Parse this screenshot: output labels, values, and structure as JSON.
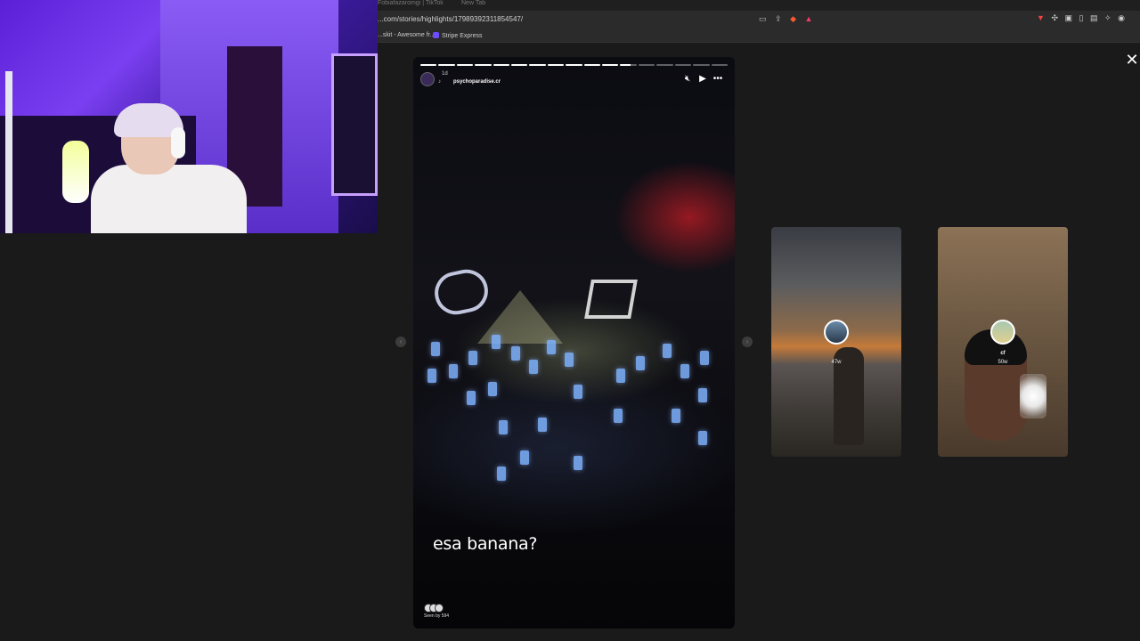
{
  "browser": {
    "tabs": [
      "Fobiafazaromgi | TikTok",
      "New Tab"
    ],
    "url": "...com/stories/highlights/17989392311854547/",
    "bookmarks": [
      "...skit - Awesome fr...",
      "Stripe Express"
    ]
  },
  "story": {
    "time_ago": "1d",
    "username": "psychoparadise.cr",
    "caption": "esa banana?",
    "seen_by": "Seen by 594",
    "progress_segments": 17,
    "completed_segments": 11,
    "current_segment_fraction": 0.6,
    "icons": [
      "mute-icon",
      "play-icon",
      "more-icon",
      "close-icon"
    ]
  },
  "previews": [
    {
      "name": "",
      "time": "47w"
    },
    {
      "name": "cf",
      "time": "50w"
    }
  ],
  "viewer": {
    "close_glyph": "✕"
  }
}
